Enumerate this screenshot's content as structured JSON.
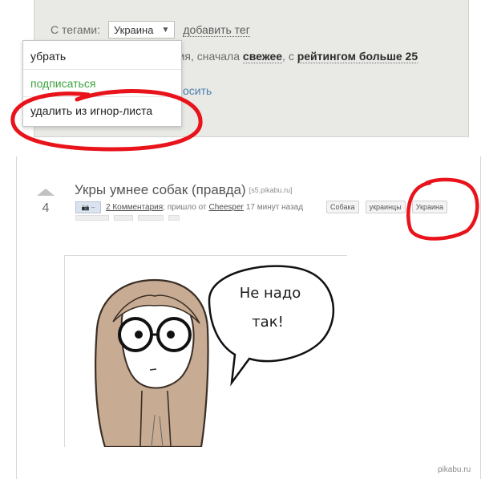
{
  "filter": {
    "tags_label": "С тегами:",
    "selected_tag": "Украина",
    "add_tag": "добавить тег",
    "sort_prefix": "емя, сначала",
    "sort_fresh": "свежее",
    "sort_sep": ", с",
    "sort_rating": "рейтингом больше 25",
    "hidden_link": "осить"
  },
  "dropdown": {
    "items": [
      {
        "label": "убрать"
      },
      {
        "label": "подписаться"
      },
      {
        "label": "удалить из игнор-листа"
      }
    ]
  },
  "post": {
    "rating": "4",
    "title": "Укры умнее собак (правда)",
    "source": "[s5.pikabu.ru]",
    "comments": "2 Комментария",
    "meta_mid": "; пришло от",
    "author": "Cheesper",
    "time": "17 минут назад",
    "tags": [
      "Собака",
      "украинцы",
      "Украина"
    ]
  },
  "comic": {
    "bubble_line1": "Не надо",
    "bubble_line2": "так!"
  },
  "watermark": "pikabu.ru",
  "colors": {
    "panel_bg": "#e9eae6",
    "markup_red": "#e8131b",
    "link_blue": "#4a7fb0",
    "subscribe_green": "#3da33d",
    "hair": "#c8ab93"
  }
}
